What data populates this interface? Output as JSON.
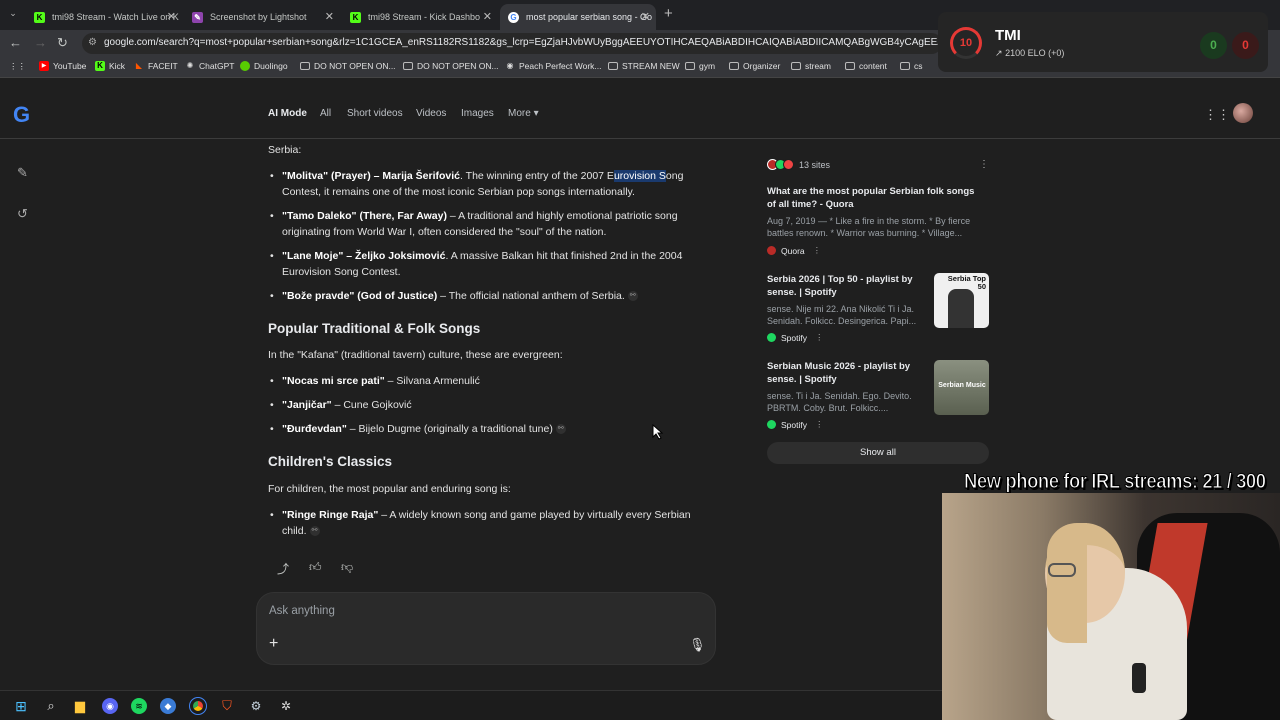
{
  "browser": {
    "tabs": [
      {
        "title": "tmi98 Stream - Watch Live on K",
        "icon": "kick-icon"
      },
      {
        "title": "Screenshot by Lightshot",
        "icon": "lightshot-icon"
      },
      {
        "title": "tmi98 Stream - Kick Dashbo",
        "icon": "kick-icon"
      },
      {
        "title": "most popular serbian song - Go",
        "icon": "google-icon"
      }
    ],
    "url": "google.com/search?q=most+popular+serbian+song&rlz=1C1GCEA_enRS1182RS1182&gs_lcrp=EgZjaHJvbWUyBggAEEUYOTIHCAEQABiABDIHCAIQABiABDIICAMQABgWGB4yCAgEEAAYFhgeMggIBRAAG",
    "bookmarks": [
      "YouTube",
      "Kick",
      "FACEIT",
      "ChatGPT",
      "Duolingo",
      "DO NOT OPEN ON...",
      "DO NOT OPEN ON...",
      "Peach Perfect Work...",
      "STREAM NEW",
      "gym",
      "Organizer",
      "stream",
      "content",
      "cs"
    ]
  },
  "google": {
    "logo": "G",
    "tabs": [
      "AI Mode",
      "All",
      "Short videos",
      "Videos",
      "Images",
      "More"
    ]
  },
  "content": {
    "intro": "Serbia:",
    "list1": [
      {
        "bold": "\"Molitva\" (Prayer) – Marija Šerifović",
        "pre": ". The winning entry of the 2007 E",
        "hl": "urovision S",
        "post": "ong Contest, it remains one of the most iconic Serbian pop songs internationally."
      },
      {
        "bold": "\"Tamo Daleko\" (There, Far Away)",
        "text": " – A traditional and highly emotional patriotic song originating from World War I, often considered the \"soul\" of the nation."
      },
      {
        "bold": "\"Lane Moje\" – Željko Joksimović",
        "text": ". A massive Balkan hit that finished 2nd in the 2004 Eurovision Song Contest."
      },
      {
        "bold": "\"Bože pravde\" (God of Justice)",
        "text": " – The official national anthem of Serbia."
      }
    ],
    "h_folk": "Popular Traditional & Folk Songs",
    "folk_intro": "In the \"Kafana\" (traditional tavern) culture, these are evergreen:",
    "list2": [
      {
        "bold": "\"Nocas mi srce pati\"",
        "text": " – Silvana Armenulić"
      },
      {
        "bold": "\"Janjičar\"",
        "text": " – Cune Gojković"
      },
      {
        "bold": "\"Đurđevdan\"",
        "text": " – Bijelo Dugme (originally a traditional tune)"
      }
    ],
    "h_children": "Children's Classics",
    "children_intro": "For children, the most popular and enduring song is:",
    "list3": [
      {
        "bold": "\"Ringe Ringe Raja\"",
        "text": " – A widely known song and game played by virtually every Serbian child."
      }
    ],
    "ask_placeholder": "Ask anything"
  },
  "sources": {
    "count": "13 sites",
    "items": [
      {
        "title": "What are the most popular Serbian folk songs of all time? - Quora",
        "snippet": "Aug 7, 2019 — * Like a fire in the storm. * By fierce battles renown. * Warrior was burning. * Village...",
        "site": "Quora",
        "color": "#b92b27"
      },
      {
        "title": "Serbia 2026 | Top 50 - playlist by sense. | Spotify",
        "snippet": "sense. Nije mi 22. Ana Nikolić Ti i Ja. Senidah. Folkicc. Desingerica. Papi...",
        "site": "Spotify",
        "color": "#1ed760",
        "thumb": "Serbia Top 50"
      },
      {
        "title": "Serbian Music 2026 - playlist by sense. | Spotify",
        "snippet": "sense. Ti i Ja. Senidah. Ego. Devito. PBRTM. Coby. Brut. Folkicc....",
        "site": "Spotify",
        "color": "#1ed760",
        "thumb": "Serbian Music"
      }
    ],
    "show_all": "Show all"
  },
  "overlay": {
    "tmi_name": "TMI",
    "tmi_level": "10",
    "tmi_elo": "2100 ELO (+0)",
    "wins": "0",
    "losses": "0",
    "goal_text": "New phone for IRL streams:  21 / 300"
  }
}
